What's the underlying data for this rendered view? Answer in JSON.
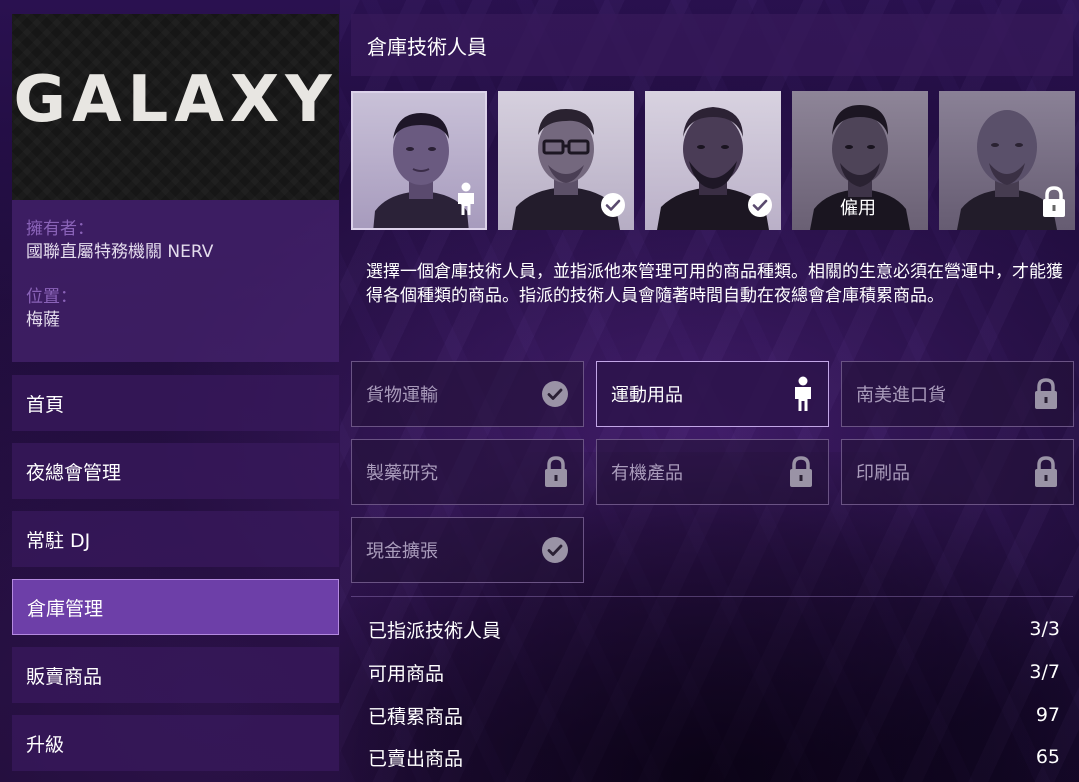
{
  "logo": {
    "text": "GALAXY"
  },
  "owner": {
    "owner_label": "擁有者：",
    "owner_value": "國聯直屬特務機關 NERV",
    "location_label": "位置：",
    "location_value": "梅薩"
  },
  "menu": [
    {
      "label": "首頁"
    },
    {
      "label": "夜總會管理"
    },
    {
      "label": "常駐 DJ"
    },
    {
      "label": "倉庫管理",
      "active": true
    },
    {
      "label": "販賣商品"
    },
    {
      "label": "升級"
    }
  ],
  "panel": {
    "title": "倉庫技術人員",
    "technicians": [
      {
        "status": "assigned",
        "icon": "person-icon"
      },
      {
        "status": "check",
        "icon": "check-circle-icon"
      },
      {
        "status": "check",
        "icon": "check-circle-icon"
      },
      {
        "status": "hire",
        "label": "僱用"
      },
      {
        "status": "locked",
        "icon": "lock-icon"
      }
    ],
    "description": "選擇一個倉庫技術人員，並指派他來管理可用的商品種類。相關的生意必須在營運中，才能獲得各個種類的商品。指派的技術人員會隨著時間自動在夜總會倉庫積累商品。",
    "goods": [
      {
        "label": "貨物運輸",
        "icon": "check-circle-icon"
      },
      {
        "label": "運動用品",
        "icon": "person-icon",
        "active": true
      },
      {
        "label": "南美進口貨",
        "icon": "lock-icon"
      },
      {
        "label": "製藥研究",
        "icon": "lock-icon"
      },
      {
        "label": "有機產品",
        "icon": "lock-icon"
      },
      {
        "label": "印刷品",
        "icon": "lock-icon"
      },
      {
        "label": "現金擴張",
        "icon": "check-circle-icon"
      }
    ],
    "stats": [
      {
        "label": "已指派技術人員",
        "value": "3/3"
      },
      {
        "label": "可用商品",
        "value": "3/7"
      },
      {
        "label": "已積累商品",
        "value": "97"
      },
      {
        "label": "已賣出商品",
        "value": "65"
      }
    ]
  },
  "colors": {
    "accent": "#6d3fa8",
    "panel": "#37195a",
    "muted_label": "#8a63b8"
  }
}
